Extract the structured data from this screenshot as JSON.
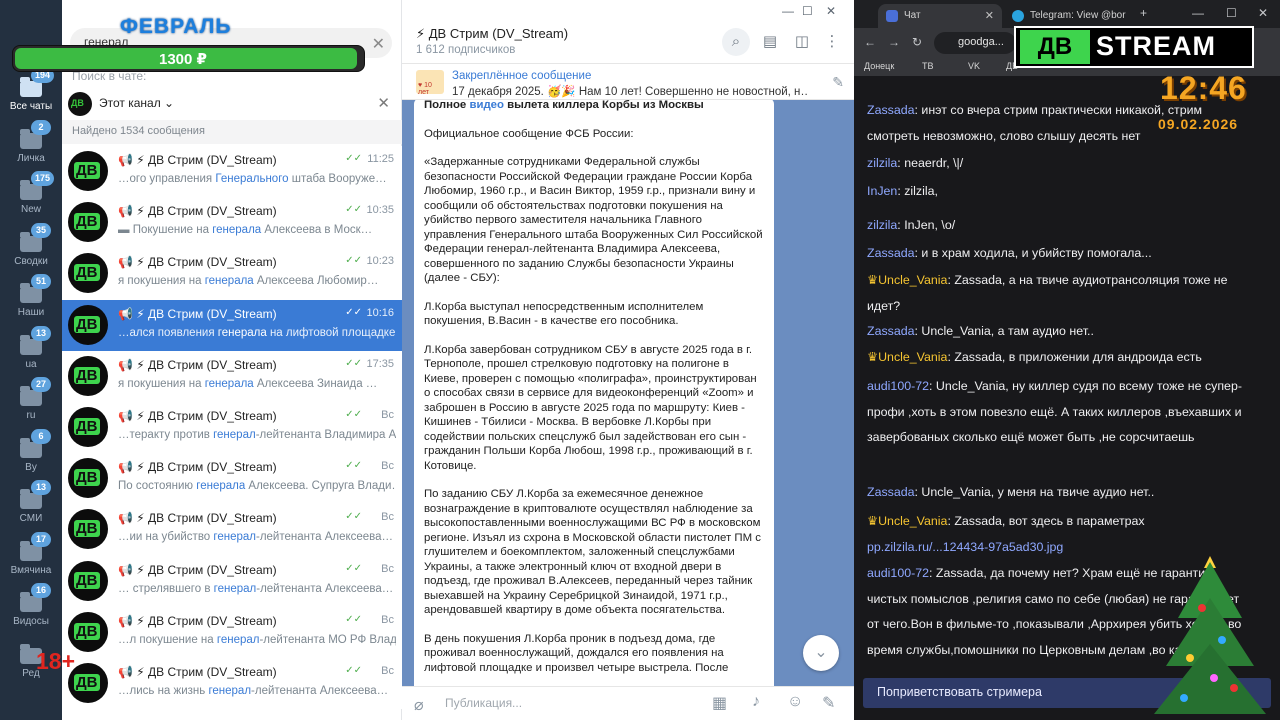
{
  "telegram": {
    "rail": [
      {
        "label": "Все чаты",
        "badge": "194",
        "active": true
      },
      {
        "label": "Личка",
        "badge": "2"
      },
      {
        "label": "New",
        "badge": "175"
      },
      {
        "label": "Сводки",
        "badge": "35"
      },
      {
        "label": "Наши",
        "badge": "51"
      },
      {
        "label": "ua",
        "badge": "13"
      },
      {
        "label": "ru",
        "badge": "27"
      },
      {
        "label": "By",
        "badge": "6"
      },
      {
        "label": "СМИ",
        "badge": "13"
      },
      {
        "label": "Вмячина",
        "badge": "17"
      },
      {
        "label": "Видосы",
        "badge": "16"
      },
      {
        "label": "Ред",
        "badge": ""
      }
    ],
    "search": {
      "value": "генерал",
      "hint": "Поиск в чате:"
    },
    "filter": {
      "avatar": "ДВ",
      "label": "Этот канал ⌄"
    },
    "found": "Найдено 1534 сообщения",
    "rows": [
      {
        "name": "📢 ⚡ ДВ Стрим (DV_Stream)",
        "time": "11:25",
        "pre": "…ого управления ",
        "hl": "Генерального",
        "post": " штаба Вооруже…"
      },
      {
        "name": "📢 ⚡ ДВ Стрим (DV_Stream)",
        "time": "10:35",
        "pre": "▬ Покушение на ",
        "hl": "генерала",
        "post": " Алексеева в Моск…"
      },
      {
        "name": "📢 ⚡ ДВ Стрим (DV_Stream)",
        "time": "10:23",
        "pre": "я покушения на ",
        "hl": "генерала",
        "post": " Алексеева Любомир…"
      },
      {
        "name": "📢 ⚡ ДВ Стрим (DV_Stream)",
        "time": "10:16",
        "pre": "…ался появления ",
        "hl": "генерала",
        "post": " на лифтовой площадке …",
        "selected": true
      },
      {
        "name": "📢 ⚡ ДВ Стрим (DV_Stream)",
        "time": "17:35",
        "pre": "я покушения на ",
        "hl": "генерала",
        "post": " Алексеева Зинаида …"
      },
      {
        "name": "📢 ⚡ ДВ Стрим (DV_Stream)",
        "time": "Вс",
        "pre": "…теракту против ",
        "hl": "генерал",
        "post": "-лейтенанта Владимира А…"
      },
      {
        "name": "📢 ⚡ ДВ Стрим (DV_Stream)",
        "time": "Вс",
        "pre": "По состоянию ",
        "hl": "генерала",
        "post": " Алексеева. Супруга Влади…"
      },
      {
        "name": "📢 ⚡ ДВ Стрим (DV_Stream)",
        "time": "Вс",
        "pre": "…ии на убийство ",
        "hl": "генерал",
        "post": "-лейтенанта Алексеева…"
      },
      {
        "name": "📢 ⚡ ДВ Стрим (DV_Stream)",
        "time": "Вс",
        "pre": "… стрелявшего в ",
        "hl": "генерал",
        "post": "-лейтенанта Алексеева…"
      },
      {
        "name": "📢 ⚡ ДВ Стрим (DV_Stream)",
        "time": "Вс",
        "pre": "…л покушение на ",
        "hl": "генерал",
        "post": "-лейтенанта МО РФ Влад…"
      },
      {
        "name": "📢 ⚡ ДВ Стрим (DV_Stream)",
        "time": "Вс",
        "pre": "…лись на жизнь ",
        "hl": "генерал",
        "post": "-лейтенанта Алексеева…"
      }
    ],
    "header": {
      "title": "⚡ ДВ Стрим (DV_Stream)",
      "subscribers": "1 612 подписчиков"
    },
    "pinned": {
      "thumb": "♥ 10 лет",
      "title": "Закреплённое сообщение",
      "text": "17 декабря 2025. 🥳🎉 Нам 10 лет! Совершенно не новостной, н…"
    },
    "message": {
      "head_pre": "Полное ",
      "head_link": "видео",
      "head_post": " вылета киллера Корбы из Москвы",
      "paragraphs": [
        "Официальное сообщение ФСБ России:",
        "«Задержанные сотрудниками Федеральной службы безопасности Российской Федерации граждане России Корба Любомир, 1960 г.р., и Васин Виктор, 1959 г.р., признали вину и сообщили об обстоятельствах подготовки покушения на убийство первого заместителя начальника Главного управления Генерального штаба Вооруженных Сил Российской Федерации генерал-лейтенанта Владимира Алексеева, совершенного по заданию Службы безопасности Украины (далее - СБУ):",
        "Л.Корба выступал непосредственным исполнителем покушения, В.Васин - в качестве его пособника.",
        "Л.Корба завербован сотрудником СБУ в августе 2025 года в г. Тернополе, прошел стрелковую подготовку на полигоне в Киеве, проверен с помощью «полиграфа», проинструктирован о способах связи в сервисе для видеоконференций «Zoom» и заброшен в Россию в августе 2025 года по маршруту: Киев - Кишинев - Тбилиси - Москва. В вербовке Л.Корбы при содействии польских спецслужб был задействован его сын - гражданин Польши Корба Любош, 1998 г.р., проживающий в г. Котовице.",
        "По заданию СБУ Л.Корба за ежемесячное денежное вознаграждение в криптовалюте осуществлял наблюдение за высокопоставленными военнослужащими ВС РФ в московском регионе. Изъял из схрона в Московской области пистолет ПМ с глушителем и боекомплектом, заложенный спецслужбами Украины, а также электронный ключ от входной двери в подъезд, где проживал В.Алексеев, переданный через тайник выехавшей на Украину Серебрицкой Зинаидой, 1971 г.р., арендовавшей квартиру в доме объекта посягательства.",
        "В день покушения Л.Корба проник в подъезд дома, где проживал военнослужащий, дождался его появления на лифтовой площадке и произвел четыре выстрела. После"
      ]
    },
    "composer_placeholder": "Публикация...",
    "overlay": {
      "goal_title": "ФЕВРАЛЬ",
      "goal_amount": "1300 ₽",
      "goal_fill": 0.98,
      "age": "18+"
    }
  },
  "browser": {
    "tabs": [
      {
        "label": "Чат",
        "active": true
      },
      {
        "label": "Telegram: View @bor"
      }
    ],
    "address": "goodga...",
    "bookmarks": [
      "Донецк",
      "ТВ",
      "VK",
      "ДВ"
    ],
    "logo_left": "ДВ",
    "logo_right": "STREAM",
    "clock": "12:46",
    "date": "09.02.2026",
    "greet_button": "Поприветствовать стримера",
    "messages": [
      {
        "user": "Zassada",
        "text": "инэт со вчера стрим практически никакой, стрим смотреть невозможно, слово слышу десять нет"
      },
      {
        "user": "zilzila",
        "text": "neaerdr, \\|/"
      },
      {
        "user": "InJen",
        "text": "zilzila,"
      },
      {
        "user": "zilzila",
        "text": "InJen, \\o/"
      },
      {
        "user": "Zassada",
        "text": "и в храм ходила, и убийству помогала..."
      },
      {
        "user": "Uncle_Vania",
        "text": "Zassada, а на твиче аудиотрансоляция тоже не идет?",
        "vip": true
      },
      {
        "user": "Zassada",
        "text": "Uncle_Vania, а там аудио нет.."
      },
      {
        "user": "Uncle_Vania",
        "text": "Zassada, в приложении для андроида есть",
        "vip": true
      },
      {
        "user": "audi100-72",
        "text": "Uncle_Vania, ну киллер судя по всему тоже не супер-профи ,хоть в этом повезло ещё. А таких киллеров ,въехавших и завербованых сколько ещё может быть ,не сорсчитаешь"
      },
      {
        "user": "Zassada",
        "text": "Uncle_Vania, у меня на твиче аудио нет.."
      },
      {
        "user": "Uncle_Vania",
        "text": "Zassada, вот здесь в параметрах ",
        "link": "pp.zilzila.ru/...124434-97a5ad30.jpg",
        "vip": true
      },
      {
        "user": "audi100-72",
        "text": "Zassada, да почему нет? Храм ещё не гарантия чистых помыслов ,религия само по себе (любая) не гарантирует от чего.Вон в фильме-то ,показывали ,Аррхирея убить хотели во время службы,помошники по Церковным делам ,во как"
      }
    ]
  }
}
